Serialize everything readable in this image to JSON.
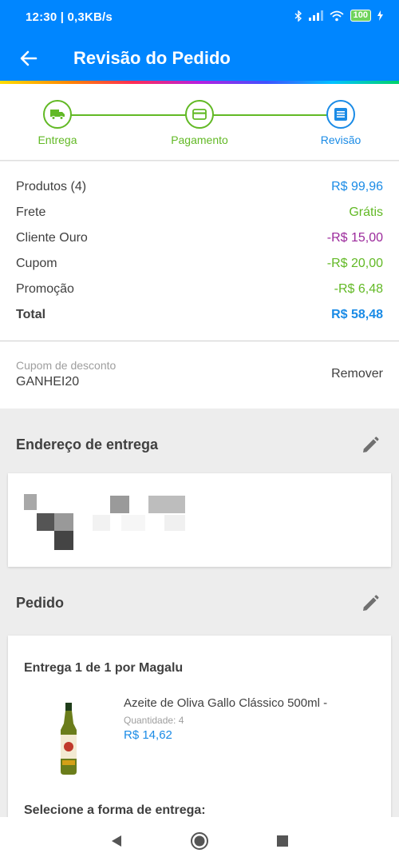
{
  "status_bar": {
    "time": "12:30 | 0,3KB/s",
    "battery": "100"
  },
  "app_bar": {
    "title": "Revisão do Pedido"
  },
  "colors": {
    "primary": "#0086ff",
    "step_done": "#62b925",
    "step_active": "#1a8be6",
    "ouro": "#9c2a9c",
    "green": "#62b925",
    "blue": "#1a8be6"
  },
  "stepper": {
    "steps": [
      {
        "label": "Entrega",
        "icon": "truck-icon",
        "state": "done"
      },
      {
        "label": "Pagamento",
        "icon": "credit-card-icon",
        "state": "done"
      },
      {
        "label": "Revisão",
        "icon": "list-icon",
        "state": "active"
      }
    ]
  },
  "summary": {
    "rows": [
      {
        "label": "Produtos (4)",
        "value": "R$ 99,96"
      },
      {
        "label": "Frete",
        "value": "Grátis"
      },
      {
        "label": "Cliente Ouro",
        "value": "-R$ 15,00"
      },
      {
        "label": "Cupom",
        "value": "-R$ 20,00"
      },
      {
        "label": "Promoção",
        "value": "-R$ 6,48"
      },
      {
        "label": "Total",
        "value": "R$ 58,48"
      }
    ]
  },
  "coupon": {
    "label": "Cupom de desconto",
    "code": "GANHEI20",
    "remove_label": "Remover"
  },
  "address": {
    "title": "Endereço de entrega"
  },
  "order": {
    "title": "Pedido",
    "delivery_heading": "Entrega 1 de 1 por Magalu",
    "product": {
      "name": "Azeite de Oliva Gallo Clássico 500ml -",
      "quantity": "Quantidade:  4",
      "price": "R$ 14,62",
      "image": "olive-oil-bottle"
    },
    "select_delivery": "Selecione a forma de entrega:"
  },
  "nav_bar": {
    "back": "back-triangle-icon",
    "home": "home-circle-icon",
    "recents": "recents-square-icon"
  }
}
